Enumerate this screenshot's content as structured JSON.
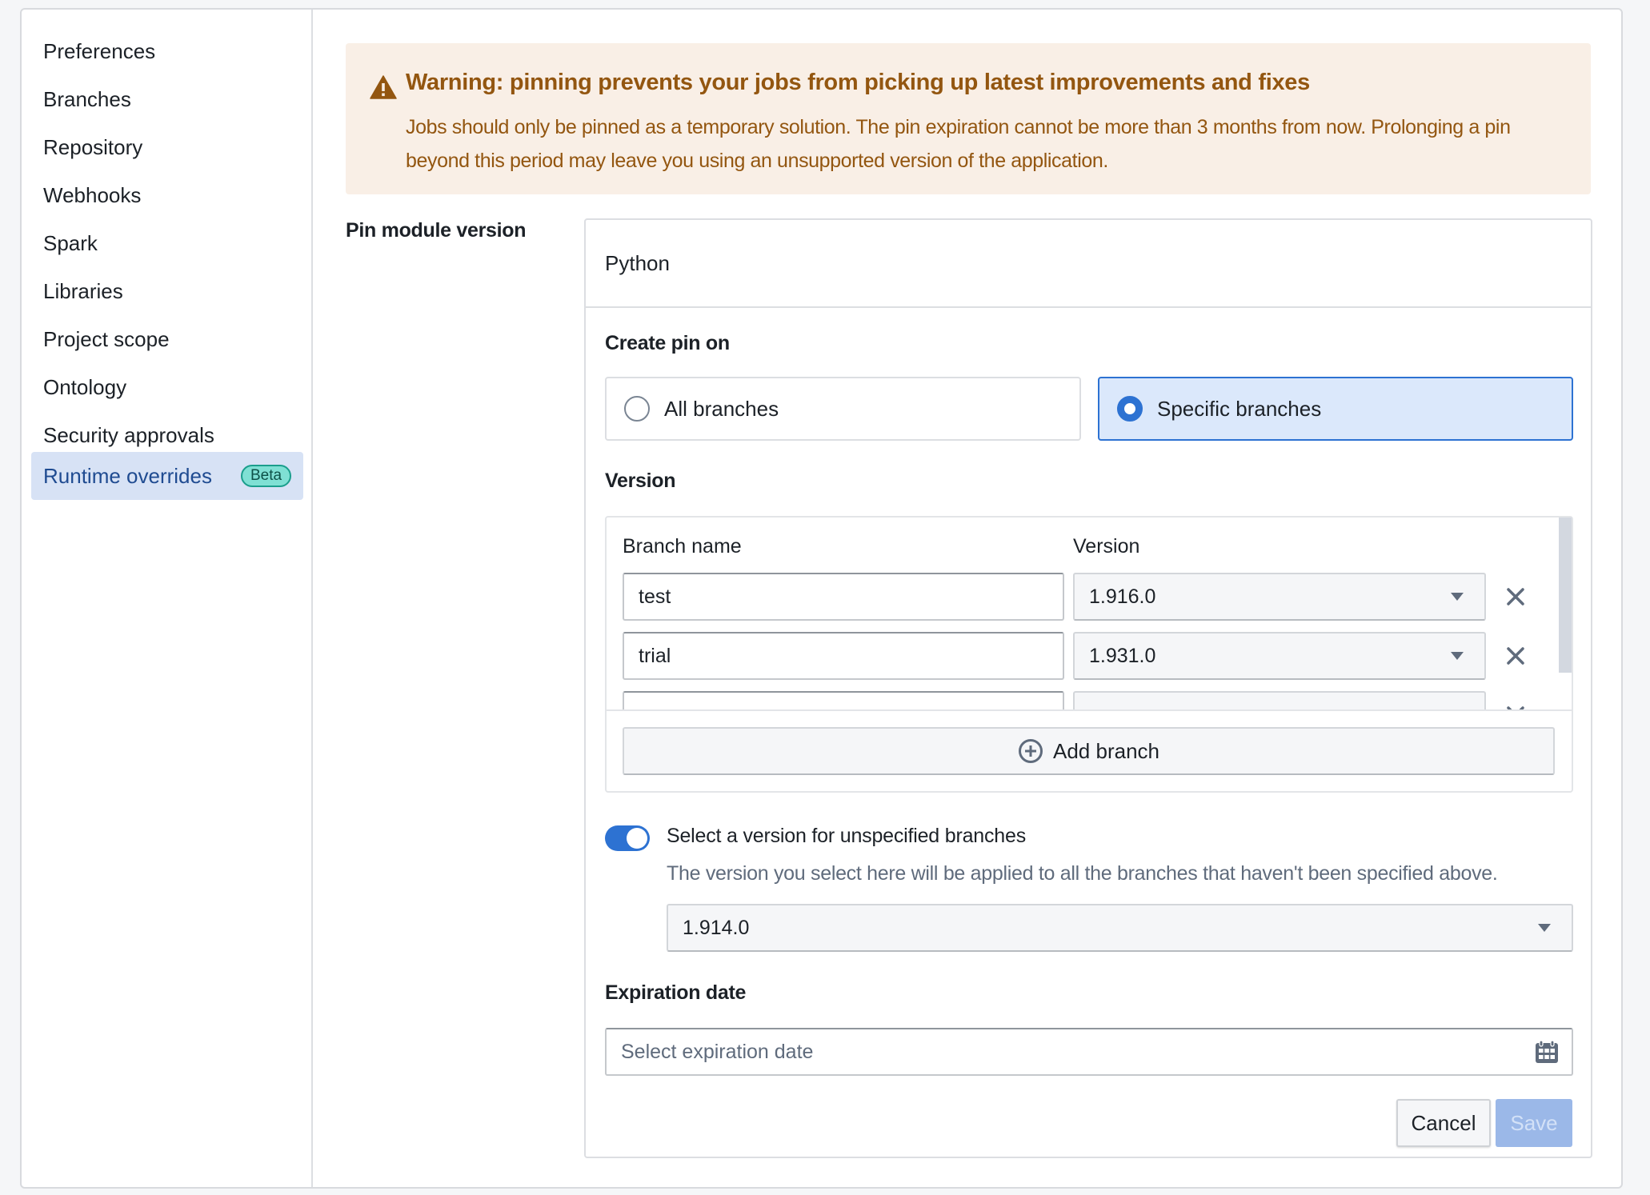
{
  "sidebar": {
    "items": [
      {
        "label": "Preferences"
      },
      {
        "label": "Branches"
      },
      {
        "label": "Repository"
      },
      {
        "label": "Webhooks"
      },
      {
        "label": "Spark"
      },
      {
        "label": "Libraries"
      },
      {
        "label": "Project scope"
      },
      {
        "label": "Ontology"
      },
      {
        "label": "Security approvals"
      },
      {
        "label": "Runtime overrides",
        "badge": "Beta",
        "active": true
      }
    ]
  },
  "warning": {
    "icon": "warning-triangle-icon",
    "title": "Warning: pinning prevents your jobs from picking up latest improvements and fixes",
    "body": "Jobs should only be pinned as a temporary solution. The pin expiration cannot be more than 3 months from now. Prolonging a pin beyond this period may leave you using an unsupported version of the application.",
    "color": "#935610",
    "background": "#f9efe6"
  },
  "form": {
    "label": "Pin module version",
    "module": "Python",
    "create_pin_on": {
      "title": "Create pin on",
      "options": [
        {
          "label": "All branches",
          "selected": false
        },
        {
          "label": "Specific branches",
          "selected": true
        }
      ]
    },
    "version_section": {
      "title": "Version",
      "columns": [
        "Branch name",
        "Version"
      ],
      "rows": [
        {
          "branch": "test",
          "version": "1.916.0"
        },
        {
          "branch": "trial",
          "version": "1.931.0"
        },
        {
          "branch": "",
          "version": ""
        }
      ],
      "add_branch_label": "Add branch"
    },
    "unspecified": {
      "toggle_on": true,
      "label": "Select a version for unspecified branches",
      "help": "The version you select here will be applied to all the branches that haven't been specified above.",
      "version": "1.914.0"
    },
    "expiration": {
      "title": "Expiration date",
      "placeholder": "Select expiration date"
    },
    "buttons": {
      "cancel": "Cancel",
      "save": "Save"
    }
  },
  "colors": {
    "accent": "#2d72d2",
    "active_nav_bg": "#d7e2f5",
    "badge_bg": "#7fe0d4"
  }
}
